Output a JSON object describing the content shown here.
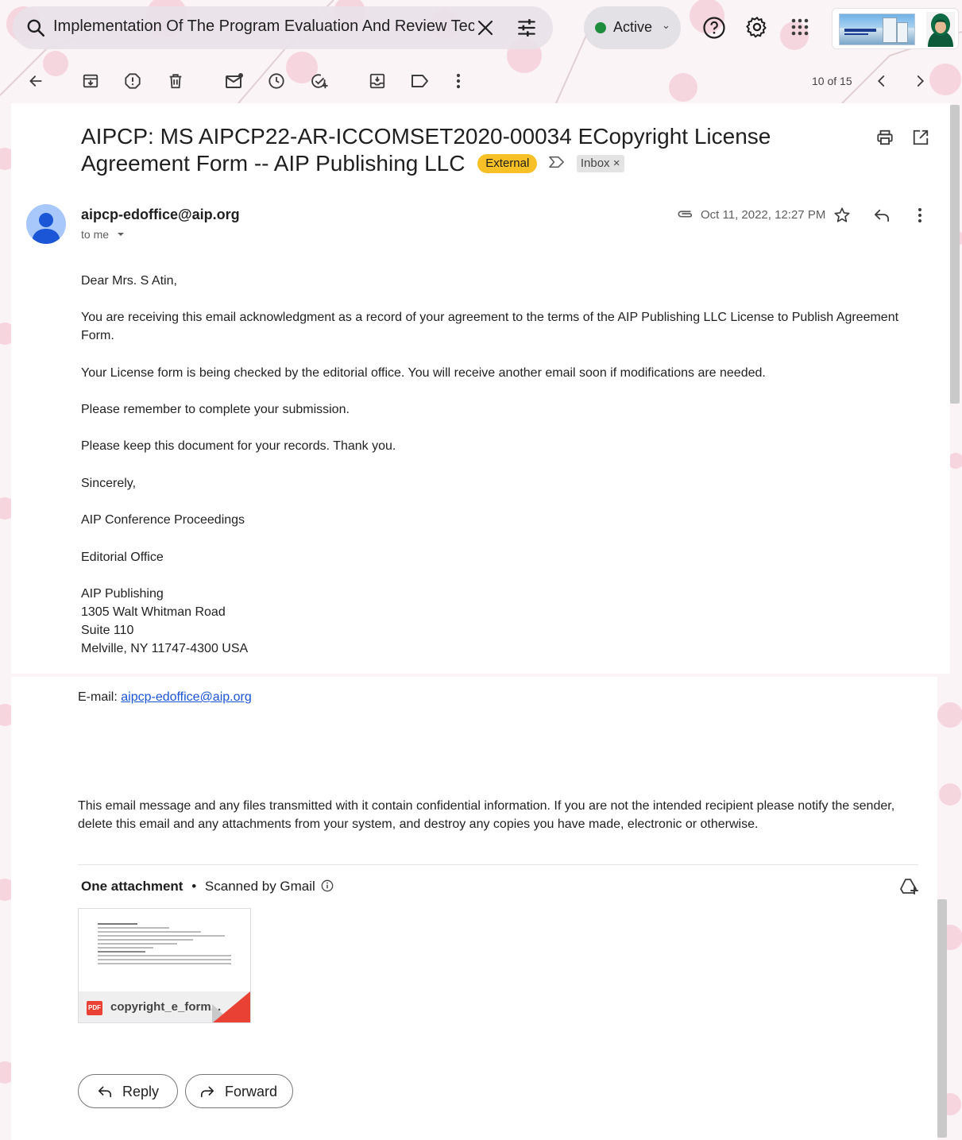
{
  "search": {
    "query": "Implementation Of The Program Evaluation And Review Techn"
  },
  "status": {
    "label": "Active",
    "color": "#1e8e3e"
  },
  "toolbar": {
    "page_count": "10 of 15"
  },
  "message": {
    "subject": "AIPCP: MS AIPCP22-AR-ICCOMSET2020-00034 ECopyright License Agreement Form -- AIP Publishing LLC",
    "external_label": "External",
    "inbox_label": "Inbox",
    "inbox_remove": "×",
    "sender": "aipcp-edoffice@aip.org",
    "recipient_label": "to me",
    "date": "Oct 11, 2022, 12:27 PM"
  },
  "body": {
    "greeting": "Dear Mrs. S Atin,",
    "p1": "You are receiving this email acknowledgment as a record of your agreement to the terms of the AIP Publishing LLC License to Publish Agreement Form.",
    "p2": "Your License form is being checked by the editorial office. You will receive another email soon if modifications are needed.",
    "p3": "Please remember to complete your submission.",
    "p4": "Please keep this document for your records. Thank you.",
    "p5": "Sincerely,",
    "p6": "AIP Conference Proceedings",
    "p7": "Editorial Office",
    "address": [
      "AIP Publishing",
      "1305 Walt Whitman Road",
      "Suite 110",
      "Melville, NY 11747-4300 USA"
    ],
    "email_prefix": "E-mail: ",
    "email_link": "aipcp-edoffice@aip.org",
    "disclaimer": "This email message and any files transmitted with it contain confidential information. If you are not the intended recipient please notify the sender, delete this email and any attachments from your system, and destroy any copies you have made, electronic or otherwise."
  },
  "attachments": {
    "heading": "One attachment",
    "separator": "•",
    "scanned": "Scanned by Gmail",
    "file_name": "copyright_e_form...",
    "file_type": "PDF"
  },
  "actions": {
    "reply": "Reply",
    "forward": "Forward"
  }
}
